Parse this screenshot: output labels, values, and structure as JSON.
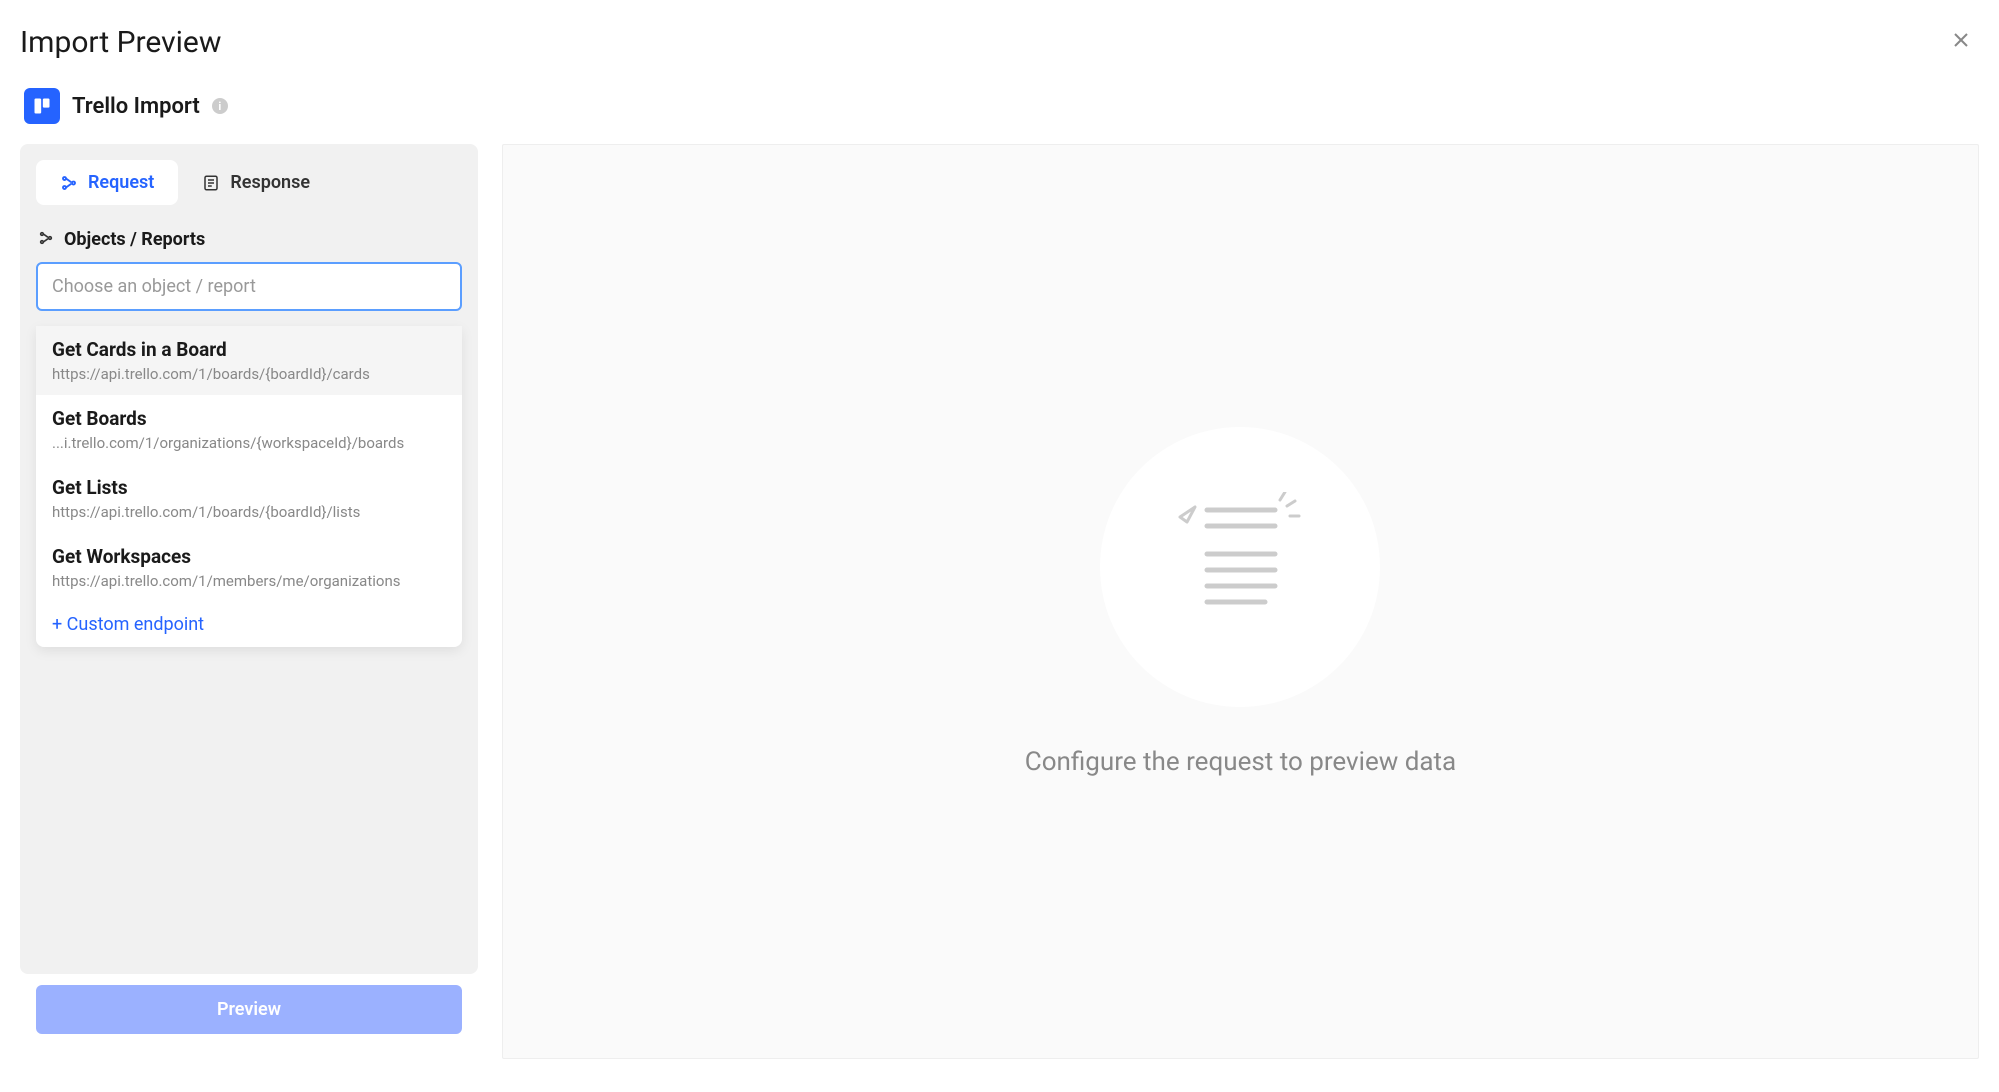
{
  "header": {
    "title": "Import Preview"
  },
  "import": {
    "name": "Trello Import"
  },
  "tabs": {
    "request": "Request",
    "response": "Response"
  },
  "section": {
    "label": "Objects / Reports",
    "placeholder": "Choose an object / report"
  },
  "dropdown": {
    "items": [
      {
        "title": "Get Cards in a Board",
        "url": "https://api.trello.com/1/boards/{boardId}/cards"
      },
      {
        "title": "Get Boards",
        "url": "...i.trello.com/1/organizations/{workspaceId}/boards"
      },
      {
        "title": "Get Lists",
        "url": "https://api.trello.com/1/boards/{boardId}/lists"
      },
      {
        "title": "Get Workspaces",
        "url": "https://api.trello.com/1/members/me/organizations"
      }
    ],
    "custom": "+ Custom endpoint"
  },
  "buttons": {
    "preview": "Preview"
  },
  "empty": {
    "message": "Configure the request to preview data"
  }
}
